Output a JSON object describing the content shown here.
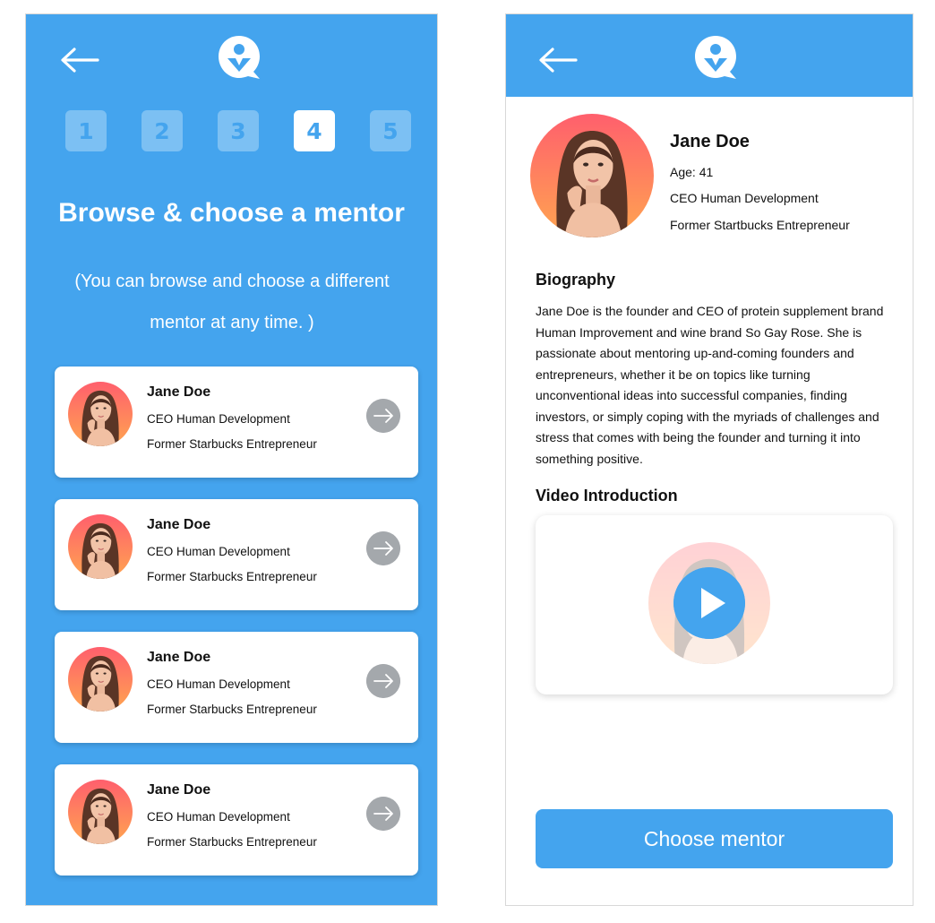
{
  "colors": {
    "brand_blue": "#44a4ee",
    "step_inactive": "#7cc0f3",
    "arrow_gray": "#a4a8ac",
    "avatar_gradient_top": "#ff5f6d",
    "avatar_gradient_bottom": "#ffa550"
  },
  "icons": {
    "back": "arrow-left-icon",
    "logo": "person-pin-chat-icon",
    "go": "arrow-right-icon",
    "play": "play-icon"
  },
  "browse_screen": {
    "steps": [
      {
        "label": "1",
        "active": false
      },
      {
        "label": "2",
        "active": false
      },
      {
        "label": "3",
        "active": false
      },
      {
        "label": "4",
        "active": true
      },
      {
        "label": "5",
        "active": false
      }
    ],
    "heading": "Browse & choose a mentor",
    "subtitle": "(You can browse and choose a different mentor at any time. )",
    "mentors": [
      {
        "name": "Jane Doe",
        "title": "CEO Human Development",
        "org": "Former Starbucks Entrepreneur"
      },
      {
        "name": "Jane Doe",
        "title": "CEO Human Development",
        "org": "Former Starbucks Entrepreneur"
      },
      {
        "name": "Jane Doe",
        "title": "CEO Human Development",
        "org": "Former Starbucks Entrepreneur"
      },
      {
        "name": "Jane Doe",
        "title": "CEO Human Development",
        "org": "Former Starbucks Entrepreneur"
      }
    ]
  },
  "profile_screen": {
    "name": "Jane Doe",
    "age": "Age: 41",
    "title": "CEO Human Development",
    "org": "Former Startbucks Entrepreneur",
    "bio_heading": "Biography",
    "bio": "Jane Doe is the founder and CEO of protein supplement brand Human Improvement and wine brand So Gay Rose. She is passionate about mentoring up-and-coming founders and entrepreneurs, whether it be on topics like turning unconventional ideas into successful companies, finding investors, or simply coping with the myriads of challenges and stress that comes with being the founder and turning it into something positive.",
    "video_heading": "Video Introduction",
    "choose_button": "Choose mentor"
  }
}
